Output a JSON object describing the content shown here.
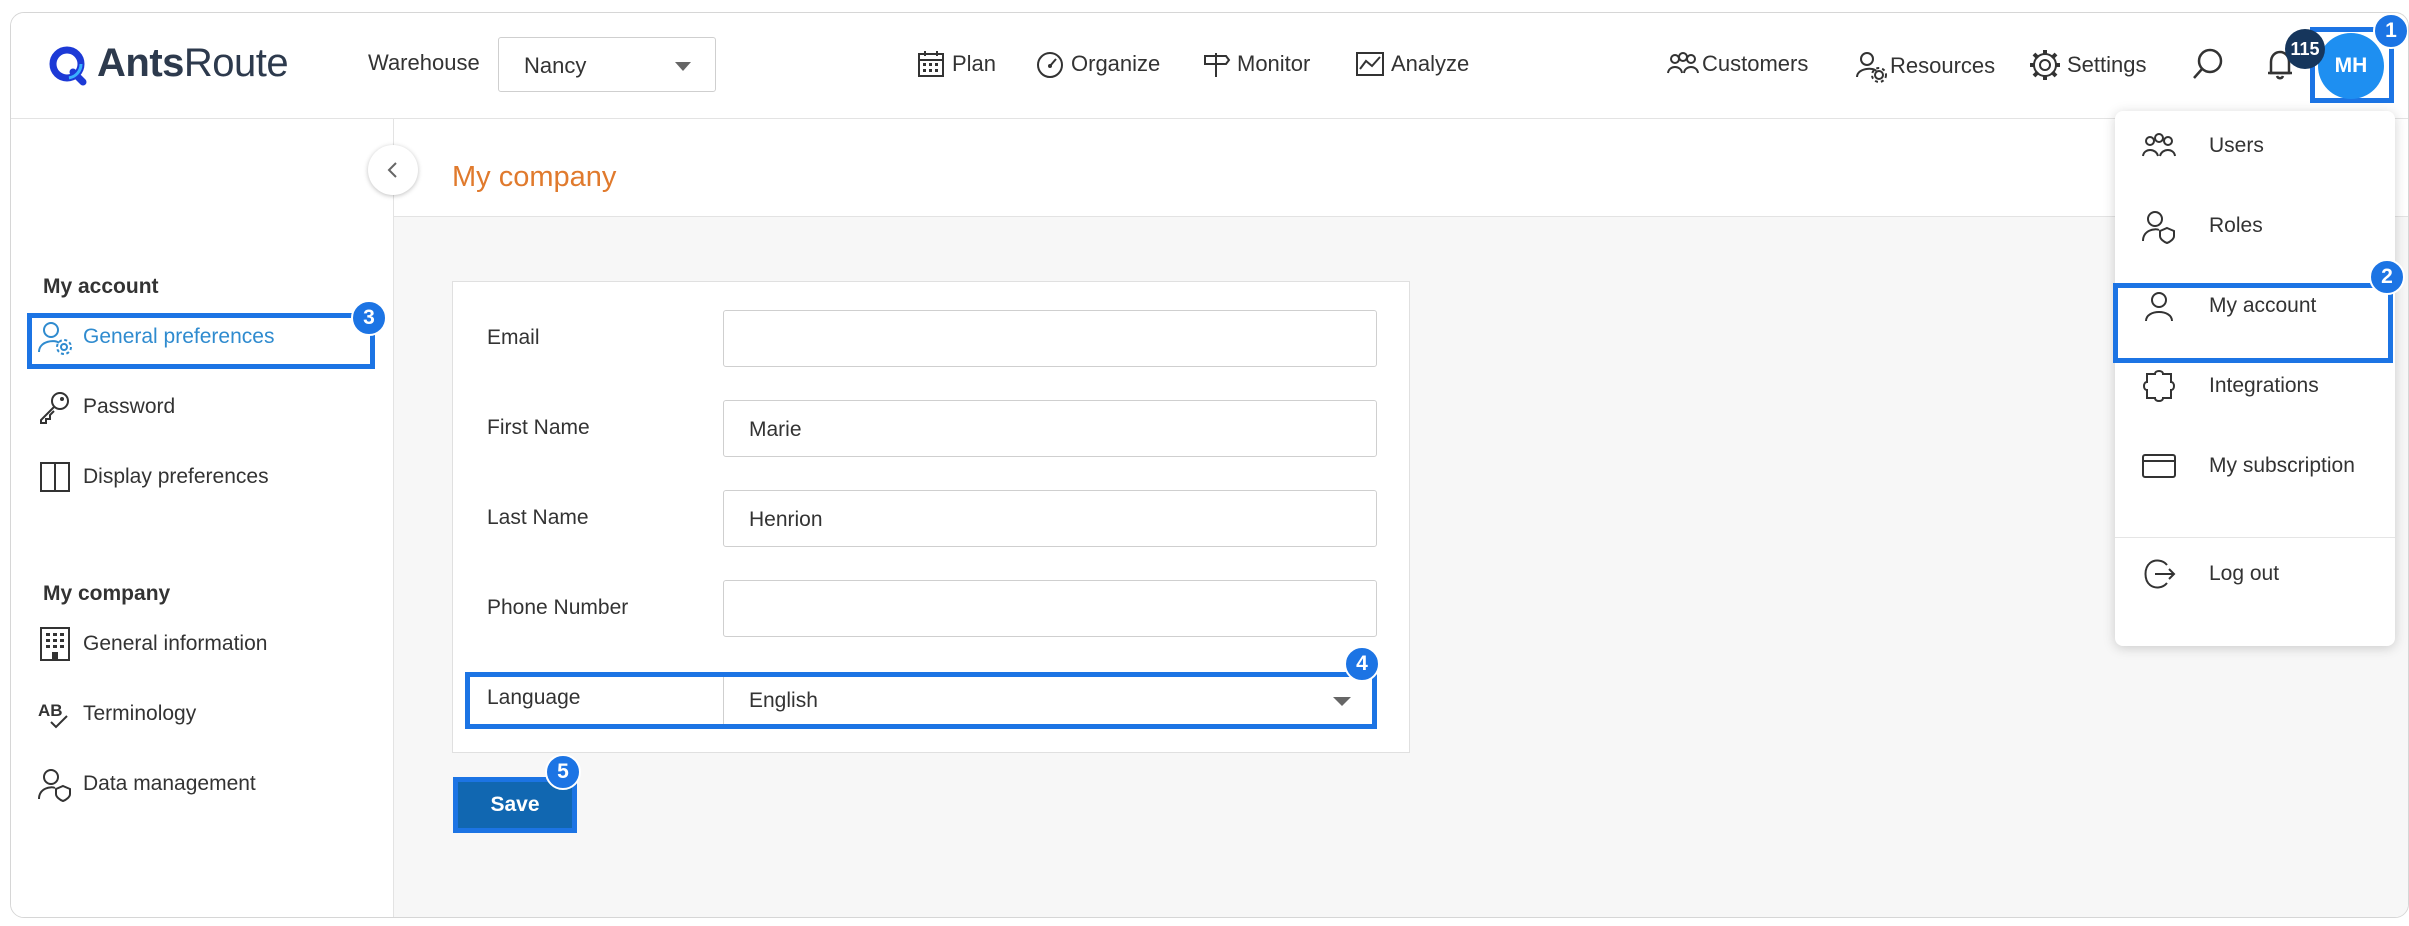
{
  "app": {
    "logo_text_bold": "Ants",
    "logo_text_light": "Route",
    "accent_color": "#1c74e4",
    "title_color": "#e07a2d"
  },
  "header": {
    "warehouse_label": "Warehouse",
    "warehouse_value": "Nancy",
    "nav": [
      {
        "label": "Plan",
        "icon": "calendar-icon"
      },
      {
        "label": "Organize",
        "icon": "speedometer-icon"
      },
      {
        "label": "Monitor",
        "icon": "signpost-icon"
      },
      {
        "label": "Analyze",
        "icon": "chart-icon"
      }
    ],
    "right_nav": [
      {
        "label": "Customers",
        "icon": "customers-icon"
      },
      {
        "label": "Resources",
        "icon": "resources-icon"
      },
      {
        "label": "Settings",
        "icon": "gear-icon"
      }
    ],
    "notification_count": "115",
    "avatar_initials": "MH"
  },
  "sidebar": {
    "section1_title": "My account",
    "section1_items": [
      {
        "label": "General preferences",
        "icon": "user-settings-icon"
      },
      {
        "label": "Password",
        "icon": "key-icon"
      },
      {
        "label": "Display preferences",
        "icon": "columns-icon"
      }
    ],
    "section2_title": "My company",
    "section2_items": [
      {
        "label": "General information",
        "icon": "building-icon"
      },
      {
        "label": "Terminology",
        "icon": "terminology-icon"
      },
      {
        "label": "Data management",
        "icon": "user-shield-icon"
      }
    ]
  },
  "main": {
    "page_title": "My company",
    "form": {
      "email_label": "Email",
      "email_value": "",
      "first_name_label": "First Name",
      "first_name_value": "Marie",
      "last_name_label": "Last Name",
      "last_name_value": "Henrion",
      "phone_label": "Phone Number",
      "phone_value": "",
      "language_label": "Language",
      "language_value": "English"
    },
    "save_label": "Save"
  },
  "dropdown": {
    "items": [
      {
        "label": "Users",
        "icon": "users-icon"
      },
      {
        "label": "Roles",
        "icon": "roles-icon"
      },
      {
        "label": "My account",
        "icon": "user-icon"
      },
      {
        "label": "Integrations",
        "icon": "puzzle-icon"
      },
      {
        "label": "My subscription",
        "icon": "card-icon"
      },
      {
        "label": "Log out",
        "icon": "logout-icon"
      }
    ]
  },
  "steps": [
    "1",
    "2",
    "3",
    "4",
    "5"
  ]
}
